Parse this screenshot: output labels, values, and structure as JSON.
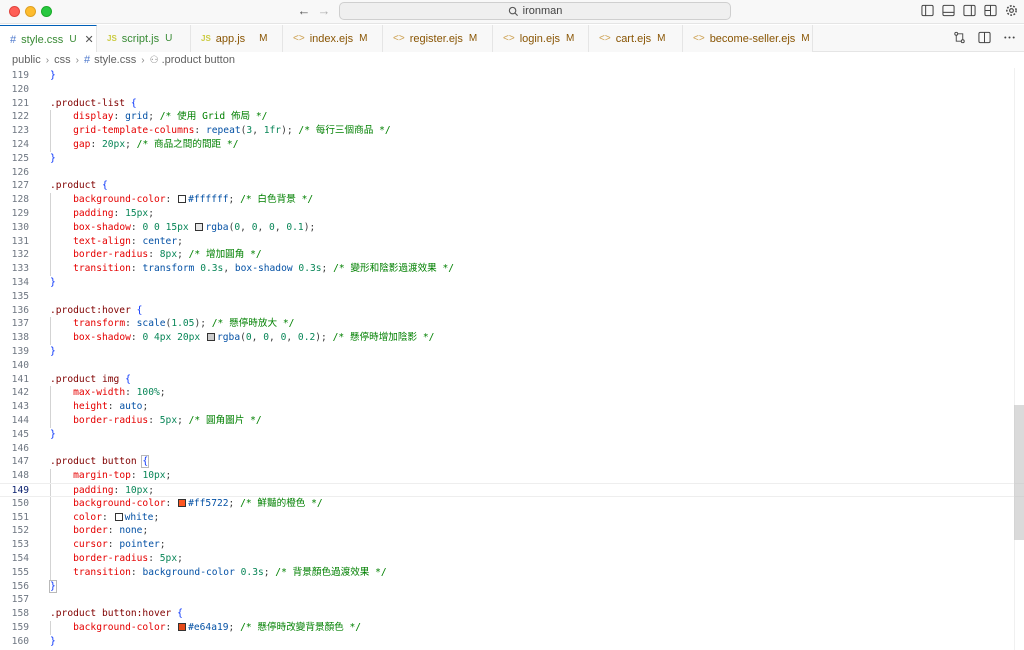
{
  "titlebar": {
    "search_text": "ironman"
  },
  "tabs": [
    {
      "label": "style.css",
      "status": "U",
      "icon": "css-hash-icon",
      "active": true
    },
    {
      "label": "script.js",
      "status": "U",
      "icon": "js-icon"
    },
    {
      "label": "app.js",
      "status": "M",
      "icon": "js-icon"
    },
    {
      "label": "index.ejs",
      "status": "M",
      "icon": "ejs-icon"
    },
    {
      "label": "register.ejs",
      "status": "M",
      "icon": "ejs-icon"
    },
    {
      "label": "login.ejs",
      "status": "M",
      "icon": "ejs-icon"
    },
    {
      "label": "cart.ejs",
      "status": "M",
      "icon": "ejs-icon"
    },
    {
      "label": "become-seller.ejs",
      "status": "M",
      "icon": "ejs-icon"
    }
  ],
  "breadcrumb": {
    "parts": [
      "public",
      "css",
      "style.css",
      ".product button"
    ]
  },
  "editor": {
    "current_line": 149,
    "lines": [
      {
        "n": "119",
        "code": "}"
      },
      {
        "n": "120",
        "code": ""
      },
      {
        "n": "121",
        "code": ".product-list {"
      },
      {
        "n": "122",
        "code": "    display: grid; /* 使用 Grid 佈局 */"
      },
      {
        "n": "123",
        "code": "    grid-template-columns: repeat(3, 1fr); /* 每行三個商品 */"
      },
      {
        "n": "124",
        "code": "    gap: 20px; /* 商品之間的間距 */"
      },
      {
        "n": "125",
        "code": "}"
      },
      {
        "n": "126",
        "code": ""
      },
      {
        "n": "127",
        "code": ".product {"
      },
      {
        "n": "128",
        "code": "    background-color: #ffffff; /* 白色背景 */"
      },
      {
        "n": "129",
        "code": "    padding: 15px;"
      },
      {
        "n": "130",
        "code": "    box-shadow: 0 0 15px rgba(0, 0, 0, 0.1);"
      },
      {
        "n": "131",
        "code": "    text-align: center;"
      },
      {
        "n": "132",
        "code": "    border-radius: 8px; /* 增加圓角 */"
      },
      {
        "n": "133",
        "code": "    transition: transform 0.3s, box-shadow 0.3s; /* 變形和陰影過渡效果 */"
      },
      {
        "n": "134",
        "code": "}"
      },
      {
        "n": "135",
        "code": ""
      },
      {
        "n": "136",
        "code": ".product:hover {"
      },
      {
        "n": "137",
        "code": "    transform: scale(1.05); /* 懸停時放大 */"
      },
      {
        "n": "138",
        "code": "    box-shadow: 0 4px 20px rgba(0, 0, 0, 0.2); /* 懸停時增加陰影 */"
      },
      {
        "n": "139",
        "code": "}"
      },
      {
        "n": "140",
        "code": ""
      },
      {
        "n": "141",
        "code": ".product img {"
      },
      {
        "n": "142",
        "code": "    max-width: 100%;"
      },
      {
        "n": "143",
        "code": "    height: auto;"
      },
      {
        "n": "144",
        "code": "    border-radius: 5px; /* 圓角圖片 */"
      },
      {
        "n": "145",
        "code": "}"
      },
      {
        "n": "146",
        "code": ""
      },
      {
        "n": "147",
        "code": ".product button {"
      },
      {
        "n": "148",
        "code": "    margin-top: 10px;"
      },
      {
        "n": "149",
        "code": "    padding: 10px;"
      },
      {
        "n": "150",
        "code": "    background-color: #ff5722; /* 鮮豔的橙色 */"
      },
      {
        "n": "151",
        "code": "    color: white;"
      },
      {
        "n": "152",
        "code": "    border: none;"
      },
      {
        "n": "153",
        "code": "    cursor: pointer;"
      },
      {
        "n": "154",
        "code": "    border-radius: 5px;"
      },
      {
        "n": "155",
        "code": "    transition: background-color 0.3s; /* 背景顏色過渡效果 */"
      },
      {
        "n": "156",
        "code": "}"
      },
      {
        "n": "157",
        "code": ""
      },
      {
        "n": "158",
        "code": ".product button:hover {"
      },
      {
        "n": "159",
        "code": "    background-color: #e64a19; /* 懸停時改變背景顏色 */"
      },
      {
        "n": "160",
        "code": "}"
      }
    ]
  },
  "colors": {
    "accent": "#005fb8",
    "swatch_ffffff": "#ffffff",
    "swatch_shadow1": "#e6e6e6",
    "swatch_shadow2": "#cccccc",
    "swatch_ff5722": "#ff5722",
    "swatch_white": "#ffffff",
    "swatch_e64a19": "#e64a19"
  }
}
